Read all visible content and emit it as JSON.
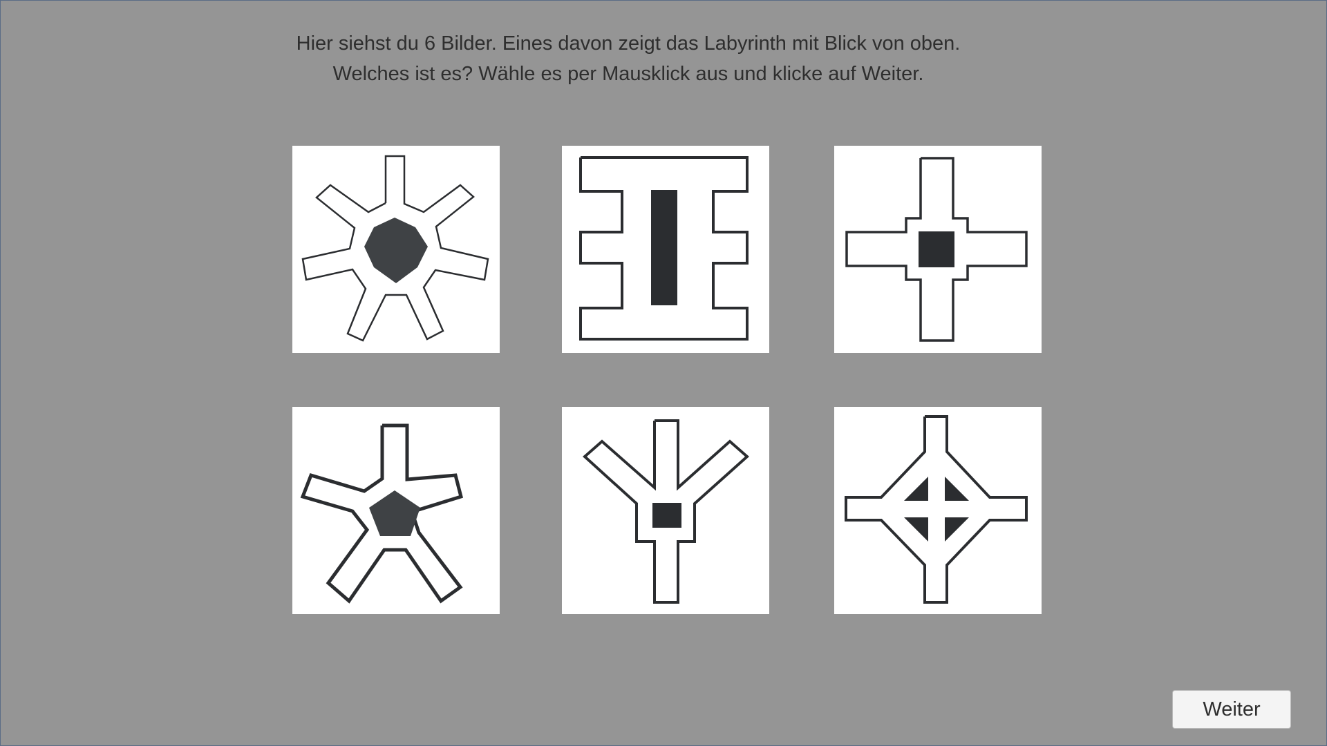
{
  "instructions": {
    "line1": "Hier siehst du 6 Bilder. Eines davon zeigt das Labyrinth mit Blick von oben.",
    "line2": "Welches ist es? Wähle es per Mausklick aus und klicke auf Weiter."
  },
  "options": [
    {
      "icon": "heptagon-seven-arm-maze-icon"
    },
    {
      "icon": "i-beam-corridor-maze-icon"
    },
    {
      "icon": "plus-cross-maze-icon"
    },
    {
      "icon": "pentagon-five-arm-maze-icon"
    },
    {
      "icon": "y-fork-maze-icon"
    },
    {
      "icon": "diamond-cross-maze-icon"
    }
  ],
  "buttons": {
    "next_label": "Weiter"
  },
  "colors": {
    "background": "#959595",
    "panel": "#ffffff",
    "ink": "#2b2d30",
    "hub_fill": "#3f4245",
    "text": "#2e2e2e",
    "button_bg": "#f4f4f4",
    "frame_border": "#5a6c86"
  }
}
